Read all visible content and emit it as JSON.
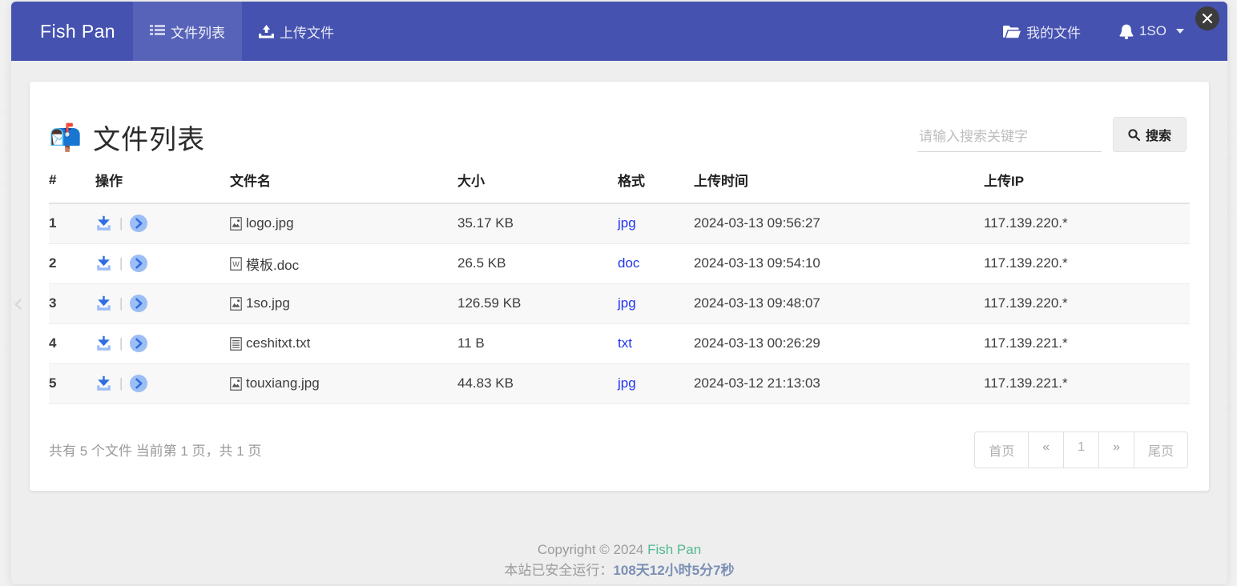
{
  "navbar": {
    "brand": "Fish Pan",
    "items": [
      {
        "label": "文件列表",
        "icon": "list-icon",
        "active": true
      },
      {
        "label": "上传文件",
        "icon": "upload-icon",
        "active": false
      }
    ],
    "right": [
      {
        "label": "我的文件",
        "icon": "folder-open-icon"
      },
      {
        "label": "1SO",
        "icon": "bell-icon",
        "caret": true
      }
    ],
    "close_icon": "close-icon",
    "bg_color": "#4552b0",
    "active_item_bg": "rgba(255,255,255,0.10)"
  },
  "card": {
    "title": "文件列表",
    "title_emoji": "📬",
    "search": {
      "placeholder": "请输入搜索关键字",
      "value": "",
      "button_label": "搜索",
      "button_icon": "search-icon"
    },
    "table": {
      "headers": [
        "#",
        "操作",
        "文件名",
        "大小",
        "格式",
        "上传时间",
        "上传IP"
      ],
      "rows": [
        {
          "index": "1",
          "actions": [
            "download-icon",
            "detail-arrow-icon"
          ],
          "file_icon": "image-file-icon",
          "filename": "logo.jpg",
          "size": "35.17 KB",
          "format": "jpg",
          "upload_time": "2024-03-13 09:56:27",
          "upload_ip": "117.139.220.*"
        },
        {
          "index": "2",
          "actions": [
            "download-icon",
            "detail-arrow-icon"
          ],
          "file_icon": "word-file-icon",
          "filename": "模板.doc",
          "size": "26.5 KB",
          "format": "doc",
          "upload_time": "2024-03-13 09:54:10",
          "upload_ip": "117.139.220.*"
        },
        {
          "index": "3",
          "actions": [
            "download-icon",
            "detail-arrow-icon"
          ],
          "file_icon": "image-file-icon",
          "filename": "1so.jpg",
          "size": "126.59 KB",
          "format": "jpg",
          "upload_time": "2024-03-13 09:48:07",
          "upload_ip": "117.139.220.*"
        },
        {
          "index": "4",
          "actions": [
            "download-icon",
            "detail-arrow-icon"
          ],
          "file_icon": "text-file-icon",
          "filename": "ceshitxt.txt",
          "size": "11 B",
          "format": "txt",
          "upload_time": "2024-03-13 00:26:29",
          "upload_ip": "117.139.221.*"
        },
        {
          "index": "5",
          "actions": [
            "download-icon",
            "detail-arrow-icon"
          ],
          "file_icon": "image-file-icon",
          "filename": "touxiang.jpg",
          "size": "44.83 KB",
          "format": "jpg",
          "upload_time": "2024-03-12 21:13:03",
          "upload_ip": "117.139.221.*"
        }
      ]
    },
    "summary": "共有 5 个文件  当前第 1 页，共 1 页",
    "pagination": [
      {
        "label": "首页",
        "name": "first"
      },
      {
        "label": "«",
        "name": "prev"
      },
      {
        "label": "1",
        "name": "page-1"
      },
      {
        "label": "»",
        "name": "next"
      },
      {
        "label": "尾页",
        "name": "last"
      }
    ]
  },
  "footer": {
    "copyright_prefix": "Copyright © 2024 ",
    "copyright_brand": "Fish Pan",
    "uptime_label": "本站已安全运行：",
    "uptime_value": "108天12小时5分7秒"
  },
  "misc": {
    "left_chevron": "‹",
    "format_link_color": "#2335f0",
    "accent_color": "#4552b0",
    "footer_brand_color": "#54b890"
  }
}
